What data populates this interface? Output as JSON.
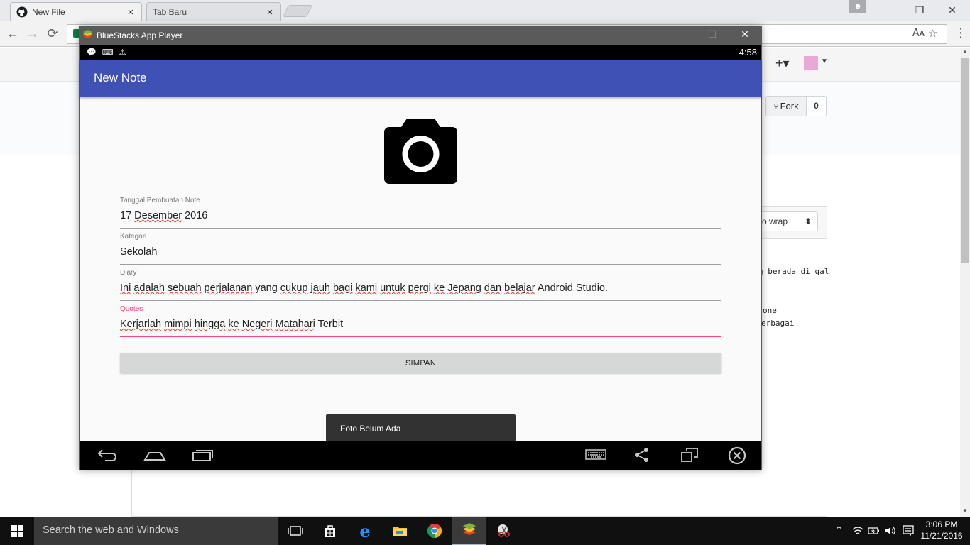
{
  "browser": {
    "tabs": [
      {
        "label": "New File",
        "close": "×",
        "icon": "github-icon"
      },
      {
        "label": "Tab Baru",
        "close": "×"
      }
    ],
    "window_controls": {
      "minimize": "—",
      "restore": "❐",
      "close": "✕"
    },
    "nav": {
      "back": "←",
      "forward": "→",
      "reload": "⟳"
    },
    "omnibox_right_icons": [
      "translate-icon",
      "star-icon"
    ],
    "menu": "⋮"
  },
  "github": {
    "plus": "+▾",
    "fork_label": "Fork",
    "fork_count": "0",
    "wrap_label": "o wrap",
    "wrap_caret": "⬍",
    "code_lines": [
      "g berada di gal",
      "one",
      "erbagai"
    ]
  },
  "bluestacks": {
    "title": "BlueStacks App Player",
    "controls": {
      "minimize": "—",
      "maximize": "☐",
      "close": "✕"
    },
    "status_time": "4:58",
    "app_title": "New Note",
    "fields": [
      {
        "label": "Tanggal Pembuatan Note",
        "value_words": [
          "17",
          "Desember",
          "2016"
        ],
        "spell_flags": [
          false,
          true,
          false
        ],
        "active": false
      },
      {
        "label": "Kategori",
        "value_words": [
          "Sekolah"
        ],
        "spell_flags": [
          false
        ],
        "active": false
      },
      {
        "label": "Diary",
        "value_words": [
          "Ini",
          "adalah",
          "sebuah",
          "perjalanan",
          "yang",
          "cukup",
          "jauh",
          "bagi",
          "kami",
          "untuk",
          "pergi",
          "ke",
          "Jepang",
          "dan",
          "belajar",
          "Android",
          "Studio."
        ],
        "spell_flags": [
          true,
          true,
          true,
          true,
          false,
          true,
          true,
          true,
          true,
          true,
          true,
          true,
          true,
          true,
          true,
          false,
          false
        ],
        "active": false
      },
      {
        "label": "Quotes",
        "value_words": [
          "Kerjarlah",
          "mimpi",
          "hingga",
          "ke",
          "Negeri",
          "Matahari",
          "Terbit"
        ],
        "spell_flags": [
          true,
          true,
          true,
          true,
          true,
          true,
          false
        ],
        "active": true
      }
    ],
    "save_button": "SIMPAN",
    "toast": "Foto Belum Ada",
    "colors": {
      "appbar": "#3f51b5",
      "accent": "#ff4081"
    }
  },
  "taskbar": {
    "search_placeholder": "Search the web and Windows",
    "clock_time": "3:06 PM",
    "clock_date": "11/21/2016",
    "tray_expand": "⌃"
  }
}
